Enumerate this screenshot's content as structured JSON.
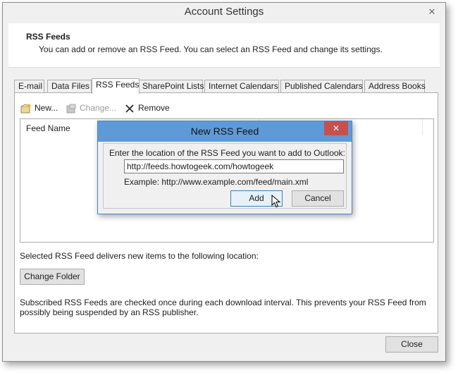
{
  "window": {
    "title": "Account Settings",
    "close_symbol": "✕"
  },
  "header": {
    "title": "RSS Feeds",
    "description": "You can add or remove an RSS Feed. You can select an RSS Feed and change its settings."
  },
  "tabs": [
    {
      "label": "E-mail"
    },
    {
      "label": "Data Files"
    },
    {
      "label": "RSS Feeds"
    },
    {
      "label": "SharePoint Lists"
    },
    {
      "label": "Internet Calendars"
    },
    {
      "label": "Published Calendars"
    },
    {
      "label": "Address Books"
    }
  ],
  "toolbar": {
    "new_label": "New...",
    "change_label": "Change...",
    "remove_label": "Remove"
  },
  "feed_list": {
    "column_header": "Feed Name"
  },
  "location_label": "Selected RSS Feed delivers new items to the following location:",
  "change_folder_label": "Change Folder",
  "note": "Subscribed RSS Feeds are checked once during each download interval. This prevents your RSS Feed from possibly being suspended by an RSS publisher.",
  "close_label": "Close",
  "dialog": {
    "title": "New RSS Feed",
    "close_symbol": "✕",
    "prompt": "Enter the location of the RSS Feed you want to add to Outlook:",
    "url_value": "http://feeds.howtogeek.com/howtogeek",
    "example": "Example: http://www.example.com/feed/main.xml",
    "add_label": "Add",
    "cancel_label": "Cancel"
  }
}
